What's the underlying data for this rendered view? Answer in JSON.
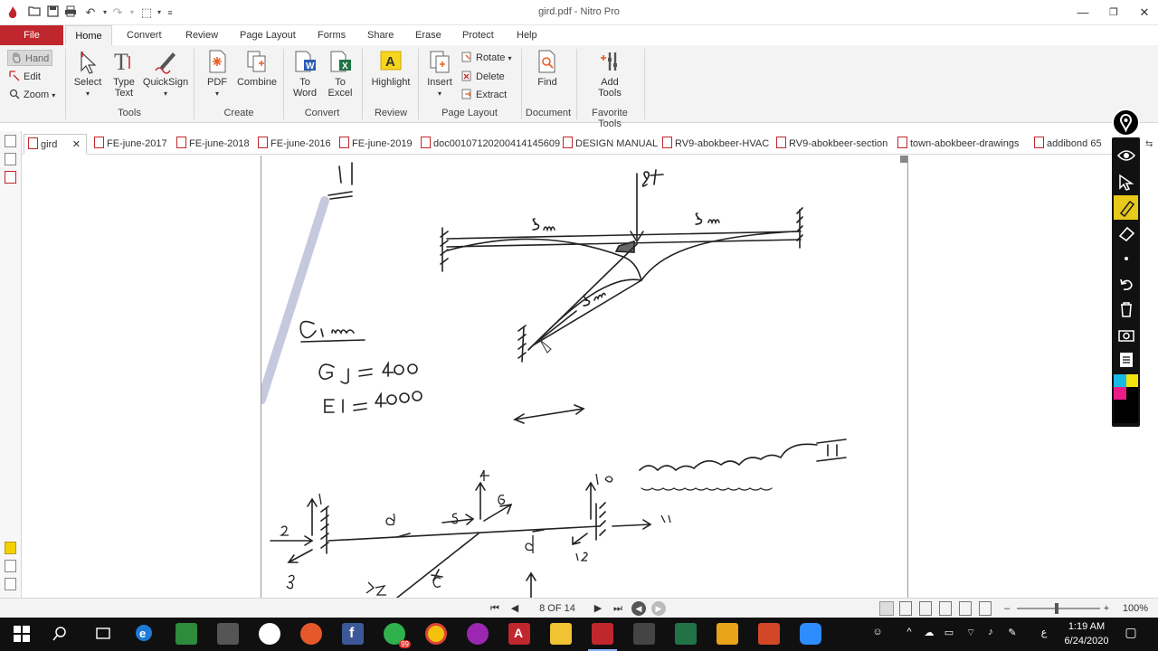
{
  "window": {
    "title": "gird.pdf - Nitro Pro"
  },
  "ribbon_tabs": [
    {
      "label": "File"
    },
    {
      "label": "Home"
    },
    {
      "label": "Convert"
    },
    {
      "label": "Review"
    },
    {
      "label": "Page Layout"
    },
    {
      "label": "Forms"
    },
    {
      "label": "Share"
    },
    {
      "label": "Erase"
    },
    {
      "label": "Protect"
    },
    {
      "label": "Help"
    }
  ],
  "ribbon": {
    "hand": "Hand",
    "edit": "Edit",
    "zoom": "Zoom",
    "select": "Select",
    "type_text_1": "Type",
    "type_text_2": "Text",
    "quicksign": "QuickSign",
    "group_tools": "Tools",
    "pdf": "PDF",
    "combine": "Combine",
    "group_create": "Create",
    "to_word_1": "To",
    "to_word_2": "Word",
    "to_excel_1": "To",
    "to_excel_2": "Excel",
    "group_convert": "Convert",
    "highlight": "Highlight",
    "group_review": "Review",
    "insert": "Insert",
    "rotate": "Rotate",
    "delete": "Delete",
    "extract": "Extract",
    "group_page_layout": "Page Layout",
    "find": "Find",
    "group_document": "Document",
    "add_tools_1": "Add",
    "add_tools_2": "Tools",
    "group_favorite": "Favorite Tools"
  },
  "doc_tabs": [
    {
      "label": "gird"
    },
    {
      "label": "FE-june-2017"
    },
    {
      "label": "FE-june-2018"
    },
    {
      "label": "FE-june-2016"
    },
    {
      "label": "FE-june-2019"
    },
    {
      "label": "doc00107120200414145609"
    },
    {
      "label": "DESIGN MANUAL"
    },
    {
      "label": "RV9-abokbeer-HVAC"
    },
    {
      "label": "RV9-abokbeer-section"
    },
    {
      "label": "town-abokbeer-drawings"
    },
    {
      "label": "addibond 65"
    }
  ],
  "statusbar": {
    "page": "8 OF 14",
    "zoom": "100%"
  },
  "taskbar": {
    "time": "1:19 AM",
    "date": "6/24/2020",
    "lang": "ع",
    "whatsapp_badge": "99"
  },
  "colors": {
    "accent": "#c0262d",
    "pen_active": "#e8c91a",
    "taskbar": "#101010"
  }
}
